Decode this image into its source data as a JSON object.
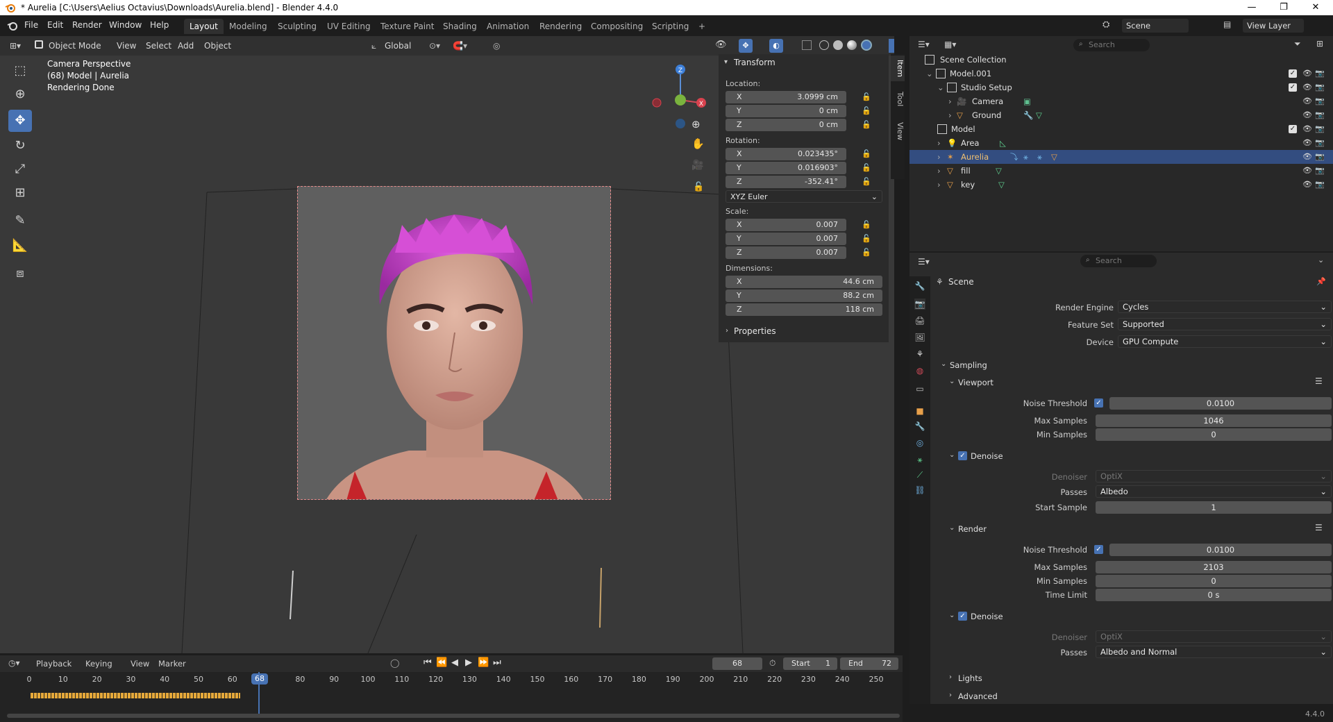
{
  "window": {
    "title": "* Aurelia [C:\\Users\\Aelius Octavius\\Downloads\\Aurelia.blend] - Blender 4.4.0",
    "minimize": "—",
    "maximize": "❐",
    "close": "✕"
  },
  "menus": [
    "File",
    "Edit",
    "Render",
    "Window",
    "Help"
  ],
  "workspaces": [
    "Layout",
    "Modeling",
    "Sculpting",
    "UV Editing",
    "Texture Paint",
    "Shading",
    "Animation",
    "Rendering",
    "Compositing",
    "Scripting"
  ],
  "workspace_add": "+",
  "scene_name": "Scene",
  "view_layer": "View Layer",
  "viewport_header": {
    "mode": "Object Mode",
    "view": "View",
    "select": "Select",
    "add": "Add",
    "object": "Object",
    "orientation": "Global"
  },
  "viewport_overlay": {
    "line1": "Camera Perspective",
    "line2": "(68) Model | Aurelia",
    "line3": "Rendering Done"
  },
  "npanel": {
    "section": "Transform",
    "location_label": "Location:",
    "location": [
      {
        "axis": "X",
        "value": "3.0999 cm"
      },
      {
        "axis": "Y",
        "value": "0 cm"
      },
      {
        "axis": "Z",
        "value": "0 cm"
      }
    ],
    "rotation_label": "Rotation:",
    "rotation": [
      {
        "axis": "X",
        "value": "0.023435°"
      },
      {
        "axis": "Y",
        "value": "0.016903°"
      },
      {
        "axis": "Z",
        "value": "-352.41°"
      }
    ],
    "rotation_mode": "XYZ Euler",
    "scale_label": "Scale:",
    "scale": [
      {
        "axis": "X",
        "value": "0.007"
      },
      {
        "axis": "Y",
        "value": "0.007"
      },
      {
        "axis": "Z",
        "value": "0.007"
      }
    ],
    "dimensions_label": "Dimensions:",
    "dimensions": [
      {
        "axis": "X",
        "value": "44.6 cm"
      },
      {
        "axis": "Y",
        "value": "88.2 cm"
      },
      {
        "axis": "Z",
        "value": "118 cm"
      }
    ],
    "properties": "Properties",
    "tabs": [
      "Item",
      "Tool",
      "View"
    ]
  },
  "gizmo": {
    "z": "Z",
    "x": "X"
  },
  "outliner": {
    "search_placeholder": "Search",
    "items": [
      {
        "name": "Scene Collection"
      },
      {
        "name": "Model.001"
      },
      {
        "name": "Studio Setup"
      },
      {
        "name": "Camera"
      },
      {
        "name": "Ground"
      },
      {
        "name": "Model"
      },
      {
        "name": "Area"
      },
      {
        "name": "Aurelia"
      },
      {
        "name": "fill"
      },
      {
        "name": "key"
      }
    ]
  },
  "properties": {
    "search_placeholder": "Search",
    "context": "Scene",
    "render_engine_label": "Render Engine",
    "render_engine": "Cycles",
    "feature_set_label": "Feature Set",
    "feature_set": "Supported",
    "device_label": "Device",
    "device": "GPU Compute",
    "sampling": "Sampling",
    "viewport": "Viewport",
    "noise_threshold_label": "Noise Threshold",
    "viewport_noise_threshold": "0.0100",
    "max_samples_label": "Max Samples",
    "viewport_max_samples": "1046",
    "min_samples_label": "Min Samples",
    "viewport_min_samples": "0",
    "denoise": "Denoise",
    "denoiser_label": "Denoiser",
    "viewport_denoiser": "OptiX",
    "passes_label": "Passes",
    "viewport_passes": "Albedo",
    "start_sample_label": "Start Sample",
    "viewport_start_sample": "1",
    "render": "Render",
    "render_noise_threshold": "0.0100",
    "render_max_samples": "2103",
    "render_min_samples": "0",
    "time_limit_label": "Time Limit",
    "render_time_limit": "0 s",
    "render_denoiser": "OptiX",
    "render_passes": "Albedo and Normal",
    "lights": "Lights",
    "advanced": "Advanced"
  },
  "timeline": {
    "playback": "Playback",
    "keying": "Keying",
    "view": "View",
    "marker": "Marker",
    "current_frame": "68",
    "start_label": "Start",
    "start": "1",
    "end_label": "End",
    "end": "72",
    "ticks": [
      "0",
      "10",
      "20",
      "30",
      "40",
      "50",
      "60",
      "68",
      "80",
      "90",
      "100",
      "110",
      "120",
      "130",
      "140",
      "150",
      "160",
      "170",
      "180",
      "190",
      "200",
      "210",
      "220",
      "230",
      "240",
      "250"
    ]
  },
  "version": "4.4.0",
  "colors": {
    "accent": "#4772b3",
    "hair": "#c83cc8",
    "selection": "#334d80"
  }
}
